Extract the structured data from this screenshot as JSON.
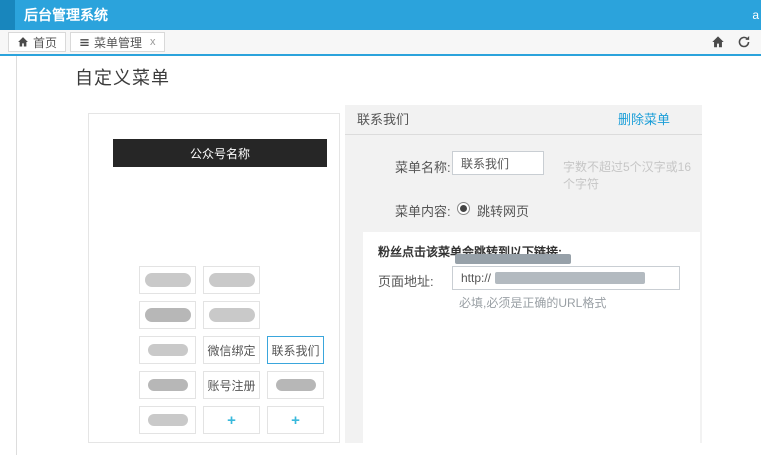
{
  "header": {
    "title": "后台管理系统",
    "user": "a"
  },
  "tabbar": {
    "tabs": [
      {
        "label": "首页"
      },
      {
        "label": "菜单管理",
        "close": "x"
      }
    ]
  },
  "page": {
    "title": "自定义菜单"
  },
  "preview": {
    "account_name": "公众号名称",
    "menu": {
      "wechat_bind": "微信绑定",
      "account_register": "账号注册",
      "contact_us": "联系我们",
      "add": "+"
    }
  },
  "detail": {
    "title": "联系我们",
    "delete_label": "删除菜单",
    "form": {
      "name_label": "菜单名称:",
      "name_value": "联系我们",
      "name_hint": "字数不超过5个汉字或16个字符",
      "content_label": "菜单内容:",
      "content_option": "跳转网页"
    },
    "link_box": {
      "tip": "粉丝点击该菜单会跳转到以下链接:",
      "address_label": "页面地址:",
      "address_prefix": "http://",
      "address_hint": "必填,必须是正确的URL格式"
    }
  },
  "colors": {
    "header_bg": "#2ba3dc",
    "header_logo_bg": "#1886bd",
    "accent_link": "#1b9ed8",
    "active_cell_border": "#3aa6dc",
    "plus": "#39b9dc",
    "phone_header_bg": "#262626",
    "panel_bg": "#f2f2f2"
  }
}
